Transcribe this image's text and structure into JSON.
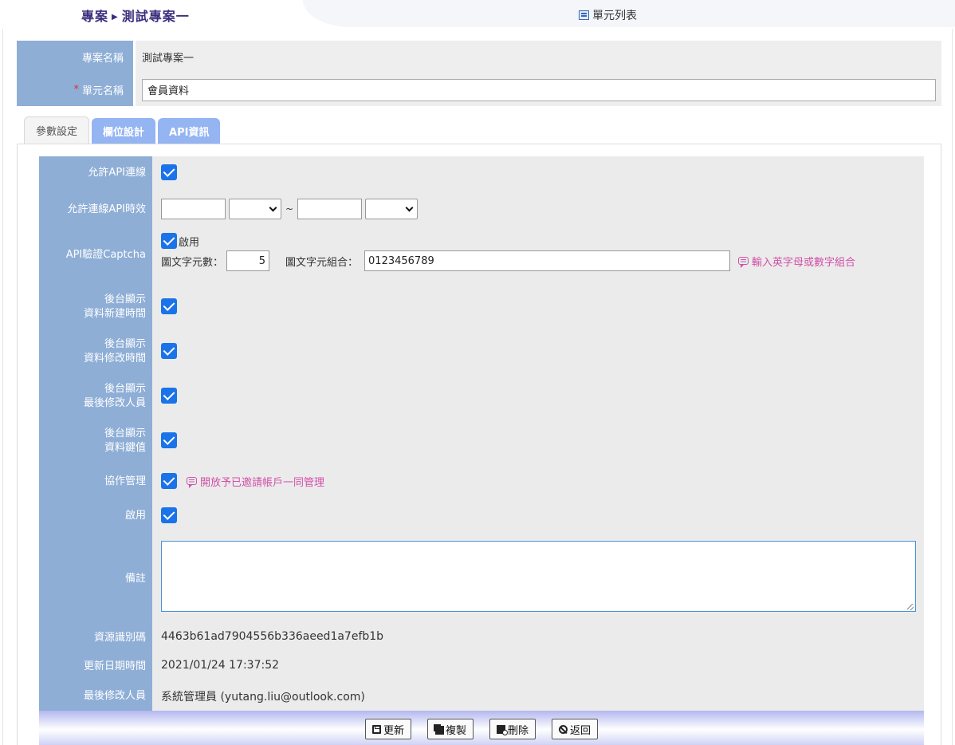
{
  "header": {
    "breadcrumb_root": "專案",
    "breadcrumb_current": "測試專案一",
    "unit_list_label": "單元列表"
  },
  "project": {
    "name_label": "專案名稱",
    "name_value": "測試專案一",
    "unit_required_mark": "*",
    "unit_label": "單元名稱",
    "unit_value": "會員資料"
  },
  "tabs": [
    {
      "label": "參數設定",
      "active": true
    },
    {
      "label": "欄位設計",
      "active": false
    },
    {
      "label": "API資訊",
      "active": false
    }
  ],
  "settings": {
    "allow_api": {
      "label": "允許API連線",
      "checked": true
    },
    "api_period": {
      "label": "允許連線API時效",
      "separator": "~",
      "start_date": "",
      "start_time": "",
      "end_date": "",
      "end_time": ""
    },
    "captcha": {
      "label": "API驗證Captcha",
      "enable_label": "啟用",
      "checked": true,
      "length_label": "圖文字元數：",
      "length_value": "5",
      "charset_label": "圖文字元組合：",
      "charset_value": "0123456789",
      "hint": "輸入英字母或數字組合"
    },
    "show_created": {
      "label_line1": "後台顯示",
      "label_line2": "資料新建時間",
      "checked": true
    },
    "show_modified": {
      "label_line1": "後台顯示",
      "label_line2": "資料修改時間",
      "checked": true
    },
    "show_modifier": {
      "label_line1": "後台顯示",
      "label_line2": "最後修改人員",
      "checked": true
    },
    "show_key": {
      "label_line1": "後台顯示",
      "label_line2": "資料鍵值",
      "checked": true
    },
    "collab": {
      "label": "協作管理",
      "checked": true,
      "hint": "開放予已邀請帳戶一同管理"
    },
    "enabled": {
      "label": "啟用",
      "checked": true
    },
    "note": {
      "label": "備註",
      "value": ""
    },
    "resource_id": {
      "label": "資源識別碼",
      "value": "4463b61ad7904556b336aeed1a7efb1b"
    },
    "updated_at": {
      "label": "更新日期時間",
      "value": "2021/01/24 17:37:52"
    },
    "last_modifier": {
      "label": "最後修改人員",
      "value": "系統管理員 (yutang.liu@outlook.com)"
    }
  },
  "buttons": {
    "update": "更新",
    "copy": "複製",
    "delete": "刪除",
    "back": "返回"
  },
  "colors": {
    "label_bg": "#8eaed6",
    "tab_inactive": "#94b4f2",
    "checkbox": "#1a73e8",
    "hint": "#d150a8",
    "breadcrumb": "#3b2e7e"
  }
}
